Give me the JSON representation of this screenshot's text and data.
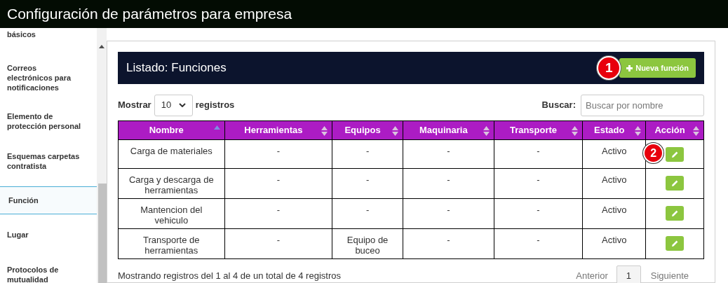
{
  "window": {
    "title": "Configuración de parámetros para empresa"
  },
  "sidebar": {
    "items": [
      {
        "label": "básicos",
        "selected": false
      },
      {
        "label": "Correos electrónicos para notificaciones",
        "selected": false
      },
      {
        "label": "Elemento de protección personal",
        "selected": false
      },
      {
        "label": "Esquemas carpetas contratista",
        "selected": false
      },
      {
        "label": "Función",
        "selected": true
      },
      {
        "label": "Lugar",
        "selected": false
      },
      {
        "label": "Protocolos de mutualidad",
        "selected": false
      }
    ]
  },
  "panel": {
    "title": "Listado: Funciones",
    "new_button": {
      "label": "Nueva función",
      "marker": "1"
    },
    "length": {
      "before": "Mostrar",
      "value": "10",
      "after": "registros"
    },
    "search": {
      "label": "Buscar:",
      "placeholder": "Buscar por nombre"
    },
    "table": {
      "columns": [
        {
          "label": "Nombre",
          "sorted": true
        },
        {
          "label": "Herramientas",
          "sorted": false
        },
        {
          "label": "Equipos",
          "sorted": false
        },
        {
          "label": "Maquinaria",
          "sorted": false
        },
        {
          "label": "Transporte",
          "sorted": false
        },
        {
          "label": "Estado",
          "sorted": false
        },
        {
          "label": "Acción",
          "sorted": false
        }
      ],
      "rows": [
        {
          "cells": [
            "Carga de materiales",
            "-",
            "-",
            "-",
            "-",
            "Activo"
          ],
          "marker": "2"
        },
        {
          "cells": [
            "Carga y descarga de herramientas",
            "-",
            "-",
            "-",
            "-",
            "Activo"
          ]
        },
        {
          "cells": [
            "Mantencion del vehiculo",
            "-",
            "-",
            "-",
            "-",
            "Activo"
          ]
        },
        {
          "cells": [
            "Transporte de herramientas",
            "-",
            "Equipo de buceo",
            "-",
            "-",
            "Activo"
          ]
        }
      ]
    },
    "info": "Mostrando registros del 1 al 4 de un total de 4 registros",
    "pagination": {
      "previous": "Anterior",
      "pages": [
        {
          "label": "1",
          "selected": true
        }
      ],
      "next": "Siguiente"
    }
  }
}
